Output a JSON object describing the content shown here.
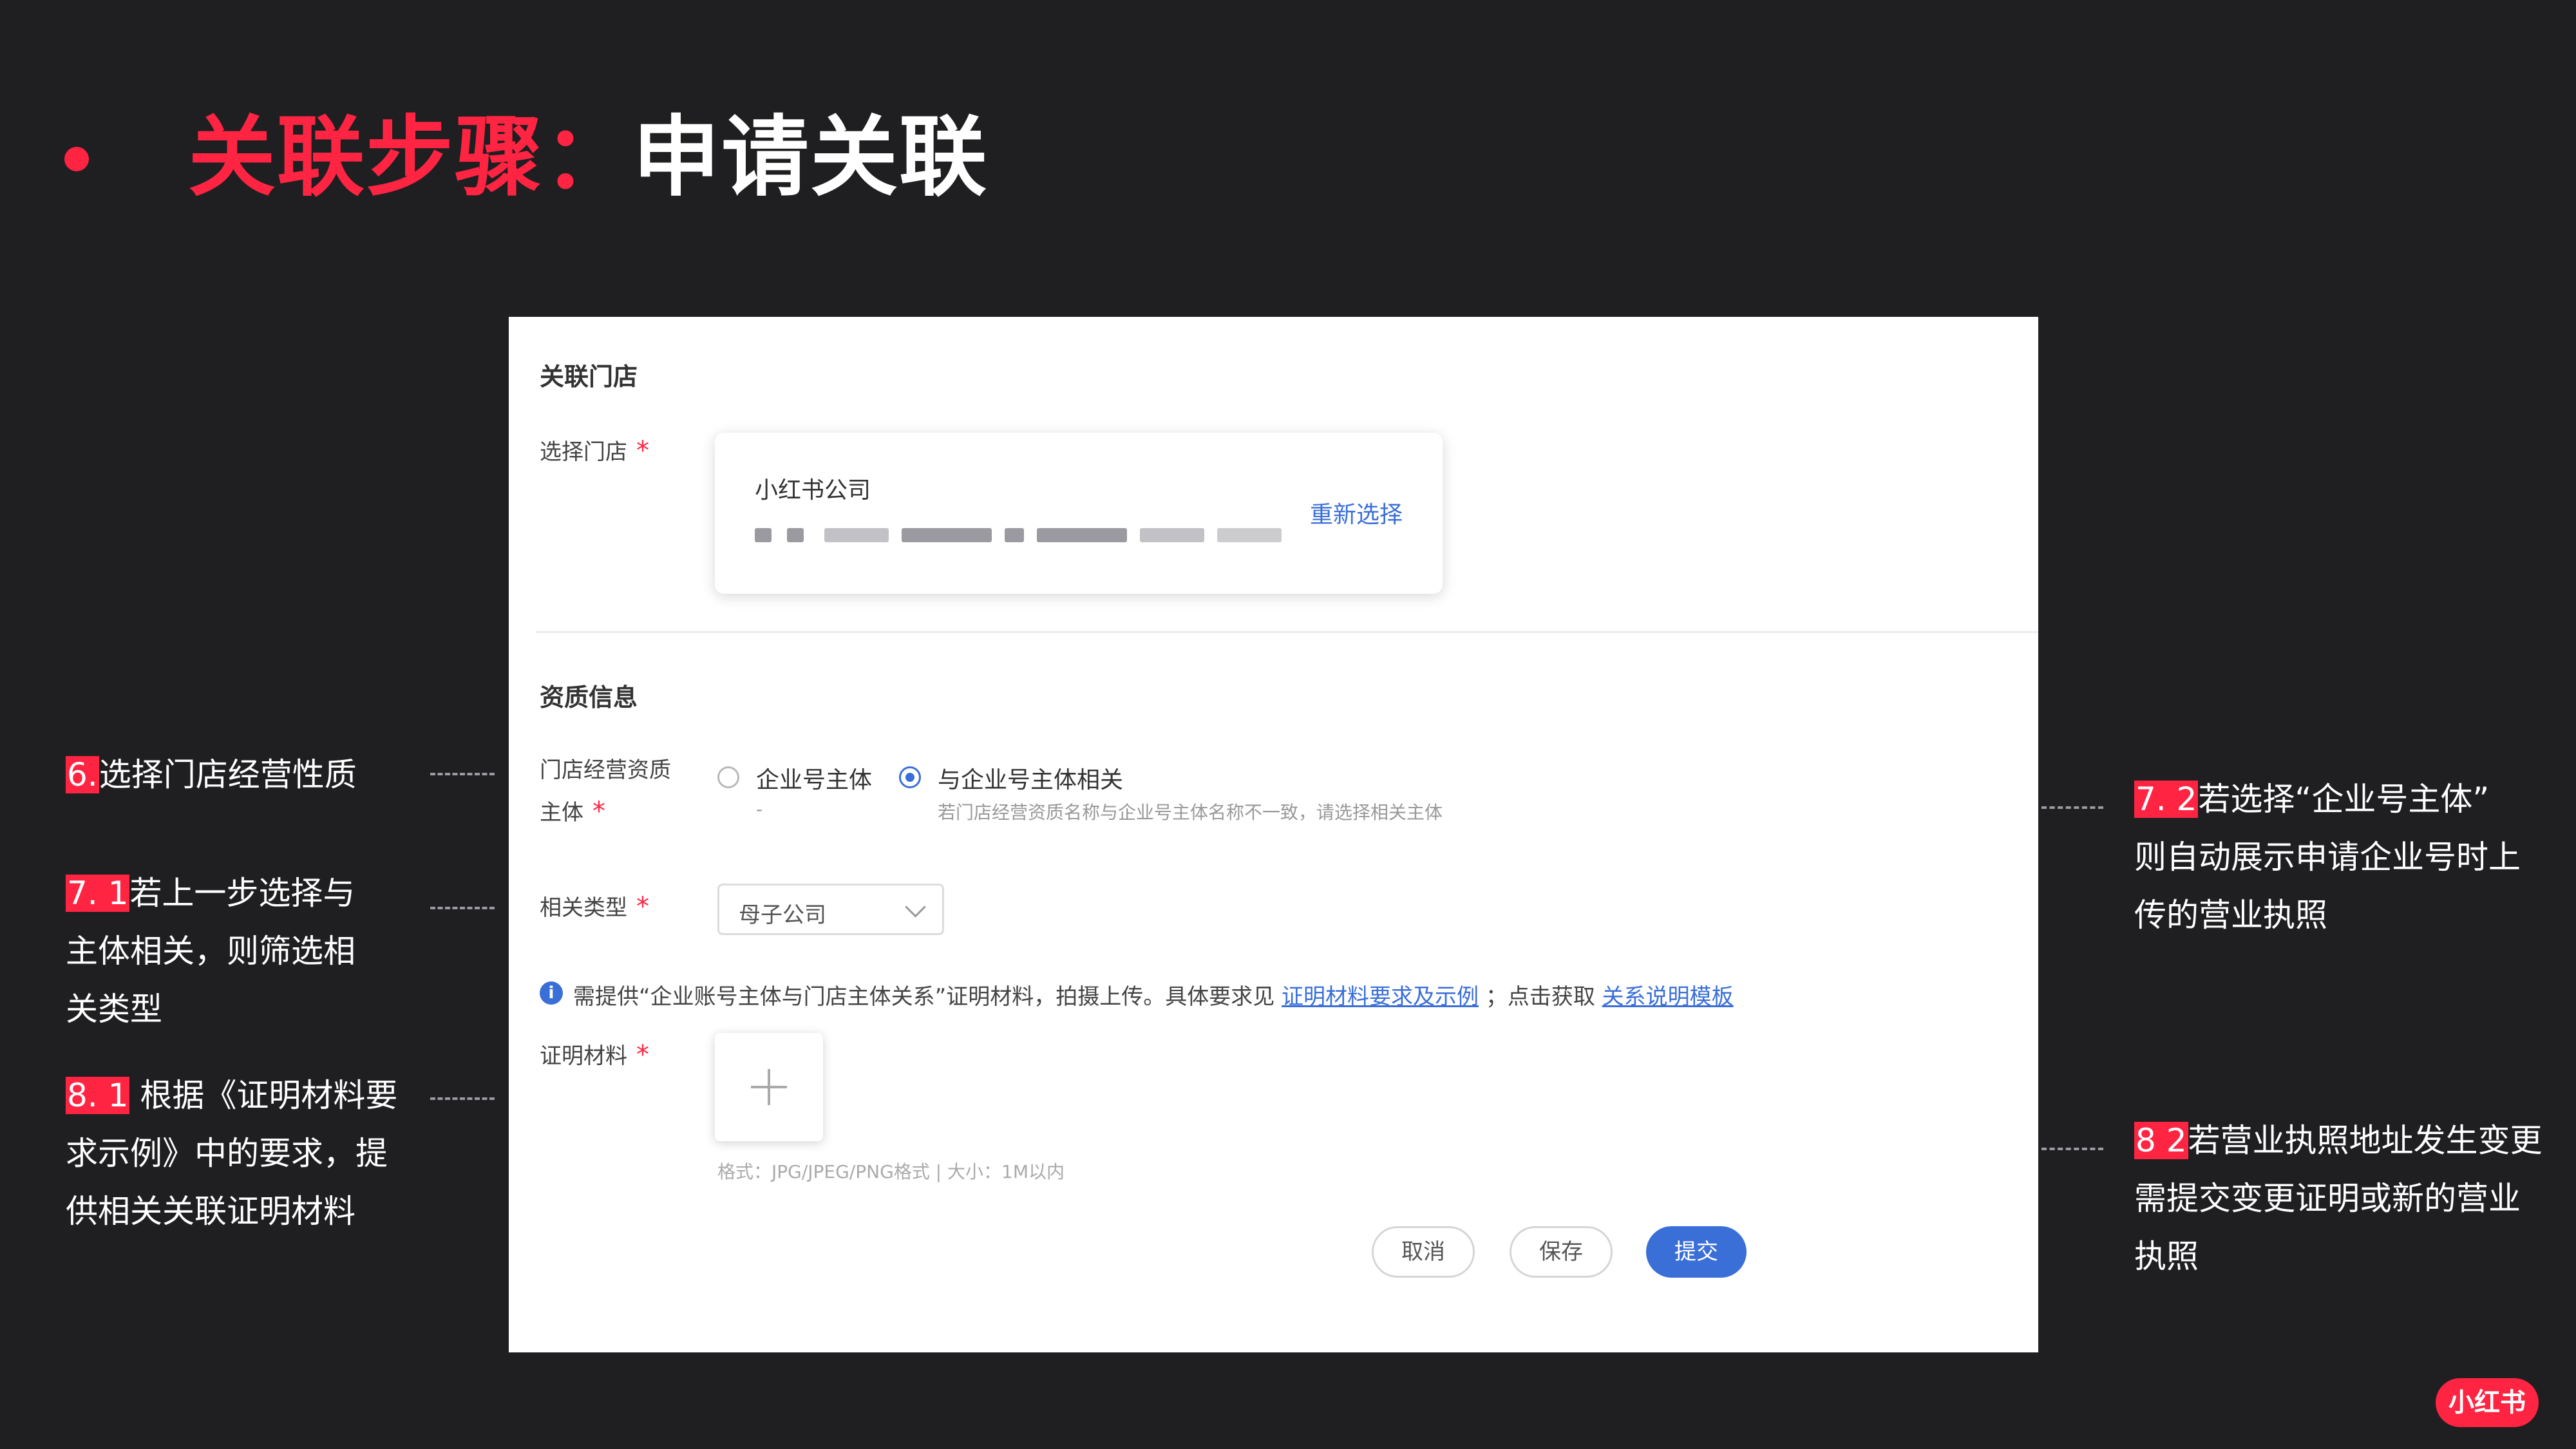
{
  "slide": {
    "title_red": "关联步骤：",
    "title_white": "申请关联"
  },
  "annotations": {
    "a6": {
      "tag": "6.",
      "lines": [
        "选择门店经营性质"
      ]
    },
    "a71": {
      "tag": "7. 1",
      "lines": [
        "若上一步选择与",
        "主体相关，则筛选相",
        "关类型"
      ]
    },
    "a81": {
      "tag": "8. 1",
      "lines": [
        " 根据《证明材料要",
        "求示例》中的要求，提",
        "供相关关联证明材料"
      ]
    },
    "a72": {
      "tag": "7. 2",
      "lines": [
        "若选择“企业号主体”",
        "则自动展示申请企业号时上",
        "传的营业执照"
      ]
    },
    "a82": {
      "tag": "8 2",
      "lines": [
        "若营业执照地址发生变更",
        "需提交变更证明或新的营业",
        "执照"
      ]
    }
  },
  "form": {
    "section_store": "关联门店",
    "select_store_label": "选择门店",
    "required_mark": "*",
    "store_name": "小红书公司",
    "reselect": "重新选择",
    "section_qual": "资质信息",
    "subject_label_1": "门店经营资质",
    "subject_label_2": "主体",
    "option_enterprise": "企业号主体",
    "option_enterprise_sub": "-",
    "option_related": "与企业号主体相关",
    "option_related_hint": "若门店经营资质名称与企业号主体名称不一致，请选择相关主体",
    "related_type_label": "相关类型",
    "related_type_value": "母子公司",
    "info_text_1": "需提供“企业账号主体与门店主体关系”证明材料，拍摄上传。具体要求见",
    "info_link_1": "证明材料要求及示例",
    "info_text_2": "；点击获取",
    "info_link_2": "关系说明模板",
    "proof_label": "证明材料",
    "format_hint": "格式：JPG/JPEG/PNG格式 | 大小：1M以内",
    "btn_cancel": "取消",
    "btn_save": "保存",
    "btn_submit": "提交"
  },
  "brand": {
    "logo_text": "小红书"
  },
  "colors": {
    "accent_red": "#ff2442",
    "link_blue": "#3a6fd8",
    "background": "#1f1f22"
  }
}
